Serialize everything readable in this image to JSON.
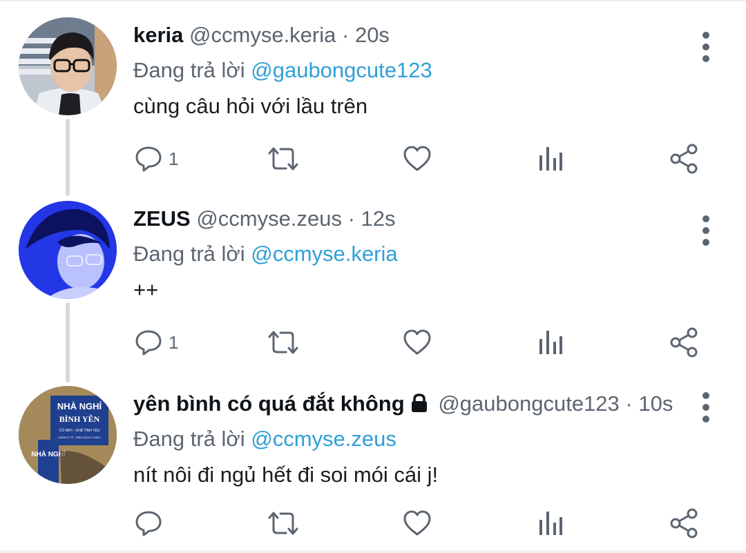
{
  "tweets": [
    {
      "name": "keria",
      "handle": "@ccmyse.keria",
      "separator": "·",
      "time": "20s",
      "locked": false,
      "replying_label": "Đang trả lời",
      "replying_to": "@gaubongcute123",
      "text": "cùng câu hỏi với lầu trên",
      "reply_count": "1",
      "avatar": "person-with-glasses-photo"
    },
    {
      "name": "ZEUS",
      "handle": "@ccmyse.zeus",
      "separator": "·",
      "time": "12s",
      "locked": false,
      "replying_label": "Đang trả lời",
      "replying_to": "@ccmyse.keria",
      "text": "++",
      "reply_count": "1",
      "avatar": "blue-lit-portrait-photo"
    },
    {
      "name": "yên bình có quá đắt không",
      "handle": "@gaubongcute123",
      "separator": "·",
      "time": "10s",
      "locked": true,
      "replying_label": "Đang trả lời",
      "replying_to": "@ccmyse.zeus",
      "text": "nít nôi đi ngủ hết đi soi mói cái j!",
      "reply_count": "",
      "avatar": "guesthouse-sign-photo",
      "avatar_sign": {
        "line1": "NHÀ NGHỈ",
        "line2": "BÌNH YÊN",
        "line3": "CÓ WIFI - GHẾ TÌNH YÊU",
        "line4": "GARA Ô TÔ - ĐIỀU HÒA 2 CHIỀU",
        "side": "NHÀ NGHỈ"
      }
    }
  ],
  "icons": {
    "reply": "reply-bubble-icon",
    "retweet": "retweet-icon",
    "like": "heart-icon",
    "views": "bar-chart-icon",
    "share": "share-icon",
    "more": "more-vertical-icon",
    "lock": "lock-icon"
  },
  "colors": {
    "mention": "#2f9fd8",
    "icon": "#5b6570",
    "thread_line": "#d3d9de"
  }
}
